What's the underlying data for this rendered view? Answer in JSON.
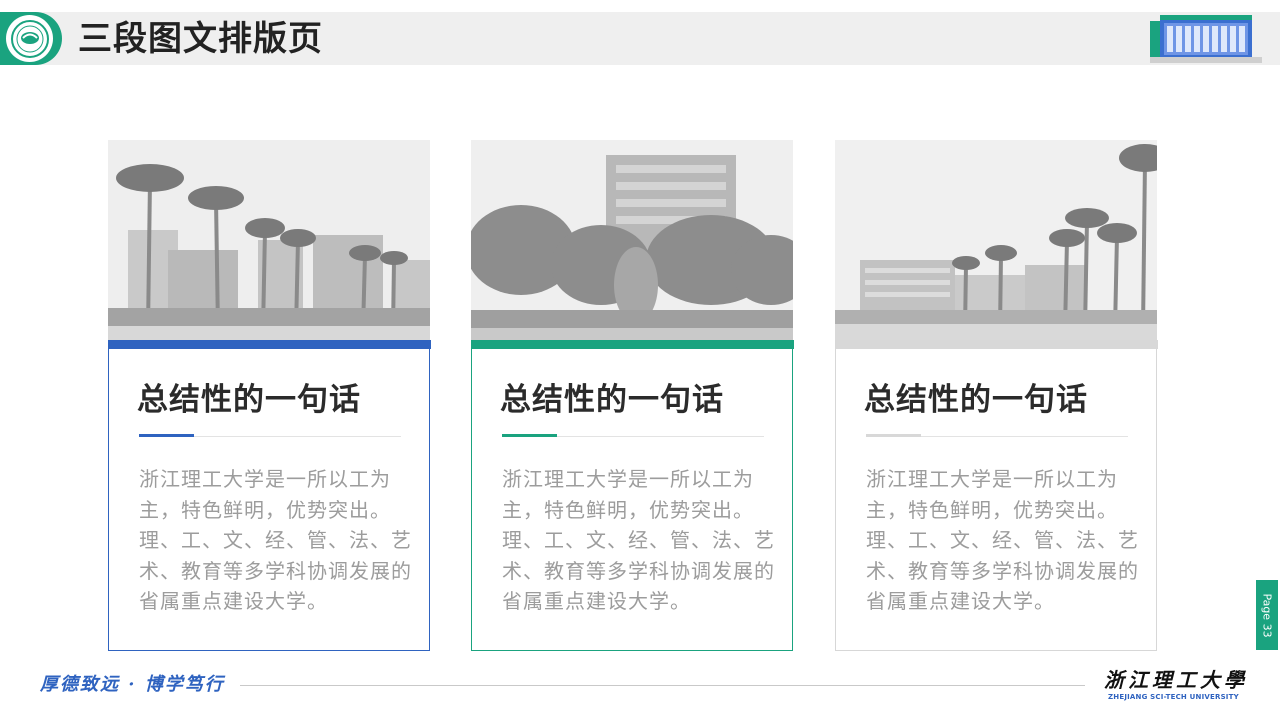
{
  "header": {
    "title": "三段图文排版页"
  },
  "colors": {
    "brand_green": "#1aa37f",
    "accent_blue": "#2f63c0",
    "accent_teal": "#1aa37f",
    "accent_gray": "#d8d8d8"
  },
  "cards": [
    {
      "heading": "总结性的一句话",
      "text": "浙江理工大学是一所以工为主，特色鲜明，优势突出。理、工、文、经、管、法、艺术、教育等多学科协调发展的省属重点建设大学。",
      "accent": "#2f63c0"
    },
    {
      "heading": "总结性的一句话",
      "text": "浙江理工大学是一所以工为主，特色鲜明，优势突出。理、工、文、经、管、法、艺术、教育等多学科协调发展的省属重点建设大学。",
      "accent": "#1aa37f"
    },
    {
      "heading": "总结性的一句话",
      "text": "浙江理工大学是一所以工为主，特色鲜明，优势突出。理、工、文、经、管、法、艺术、教育等多学科协调发展的省属重点建设大学。",
      "accent": "#d8d8d8"
    }
  ],
  "footer": {
    "motto": "厚德致远 · 博学笃行",
    "university_cn": "浙江理工大學",
    "university_en": "ZHEJIANG SCI-TECH UNIVERSITY",
    "page_label": "Page 33"
  },
  "icons": {
    "logo": "university-logo-icon",
    "building": "campus-building-icon"
  }
}
